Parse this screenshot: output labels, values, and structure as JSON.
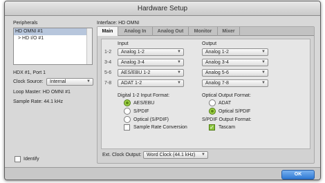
{
  "window": {
    "title": "Hardware Setup"
  },
  "peripherals": {
    "heading": "Peripherals",
    "items": [
      "HD OMNI #1",
      "> HD I/O #1"
    ],
    "port_label": "HDX #1, Port 1",
    "clock_source_label": "Clock Source:",
    "clock_source_value": "Internal",
    "loop_master": "Loop Master: HD OMNI #1",
    "sample_rate": "Sample Rate: 44.1 kHz",
    "identify_label": "Identify"
  },
  "interface": {
    "label": "Interface: HD OMNI",
    "tabs": [
      "Main",
      "Analog In",
      "Analog Out",
      "Monitor",
      "Mixer"
    ],
    "input_heading": "Input",
    "output_heading": "Output",
    "rows": [
      {
        "channel": "1-2",
        "input": "Analog 1-2",
        "output": "Analog 1-2"
      },
      {
        "channel": "3-4",
        "input": "Analog 3-4",
        "output": "Analog 3-4"
      },
      {
        "channel": "5-6",
        "input": "AES/EBU 1-2",
        "output": "Analog 5-6"
      },
      {
        "channel": "7-8",
        "input": "ADAT 1-2",
        "output": "Analog 7-8"
      }
    ],
    "digital_input_format": {
      "heading": "Digital 1-2 Input Format:",
      "options": [
        "AES/EBU",
        "S/PDIF",
        "Optical (S/PDIF)"
      ],
      "selected": "AES/EBU",
      "src_label": "Sample Rate Conversion",
      "src_checked": false
    },
    "optical_output_format": {
      "heading": "Optical Output Format:",
      "options": [
        "ADAT",
        "Optical S/PDIF"
      ],
      "selected": "Optical S/PDIF"
    },
    "spdif_output_format": {
      "heading": "S/PDIF Output Format:",
      "tascam_label": "Tascam",
      "tascam_checked": true
    },
    "ext_clock_label": "Ext. Clock Output:",
    "ext_clock_value": "Word Clock (44.1 kHz)"
  },
  "footer": {
    "ok_label": "OK"
  }
}
